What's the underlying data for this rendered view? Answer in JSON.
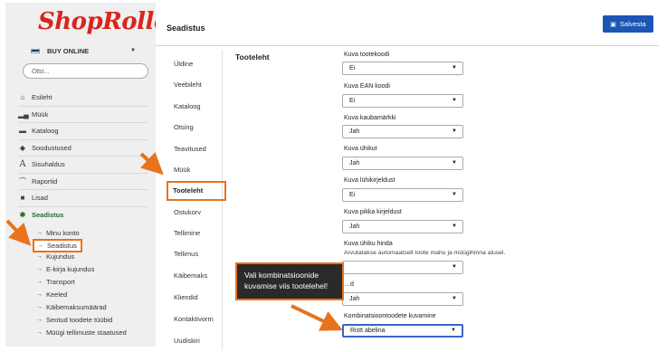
{
  "sidebar": {
    "logo": "ShopRoller",
    "store": "BUY ONLINE",
    "search_placeholder": "Otsi...",
    "nav": [
      {
        "label": "Esileht",
        "icon": "home-icon"
      },
      {
        "label": "Müük",
        "icon": "bar-chart-icon"
      },
      {
        "label": "Kataloog",
        "icon": "book-icon"
      },
      {
        "label": "Soodustused",
        "icon": "tag-icon"
      },
      {
        "label": "Sisuhaldus",
        "icon": "font-icon"
      },
      {
        "label": "Raportid",
        "icon": "line-chart-icon"
      },
      {
        "label": "Lisad",
        "icon": "puzzle-icon"
      },
      {
        "label": "Seadistus",
        "icon": "gear-icon"
      }
    ],
    "sub": [
      "Minu konto",
      "Seadistus",
      "Kujundus",
      "E-kirja kujundus",
      "Transport",
      "Keeled",
      "Käibemaksumäärad",
      "Seotud toodete tüübid",
      "Müügi tellimuste staatused"
    ]
  },
  "header": {
    "title": "Seadistus",
    "save_label": "Salvesta"
  },
  "tabs": [
    "Üldine",
    "Veebileht",
    "Kataloog",
    "Otsing",
    "Teavitused",
    "Müük",
    "Tooteleht",
    "Ostukorv",
    "Tellimine",
    "Tellimus",
    "Käibemaks",
    "Kliendid",
    "Kontaktivorm",
    "Uudiskiri"
  ],
  "active_tab": "Tooteleht",
  "section_title": "Tooteleht",
  "fields": [
    {
      "label": "Kuva tootekoodi",
      "value": "Ei"
    },
    {
      "label": "Kuva EAN koodi",
      "value": "Ei"
    },
    {
      "label": "Kuva kaubamärkki",
      "value": "Jah"
    },
    {
      "label": "Kuva ühikut",
      "value": "Jah"
    },
    {
      "label": "Kuva lühikirjeldust",
      "value": "Ei"
    },
    {
      "label": "Kuva pikka kirjeldust",
      "value": "Jah"
    },
    {
      "label": "Kuva ühiku hinda",
      "hint": "Arvutatakse automaatselt toote mahu ja müügihinna alusel.",
      "value": ""
    },
    {
      "label": "…d",
      "value": "Jah"
    },
    {
      "label": "Kombinatsioontoodete kuvamine",
      "value": "Ristt abelina"
    }
  ],
  "callout": "Vali kombinatsioonide kuvamise viis tootelehel!",
  "accent_color": "#e8731c",
  "button_color": "#1c56b5"
}
